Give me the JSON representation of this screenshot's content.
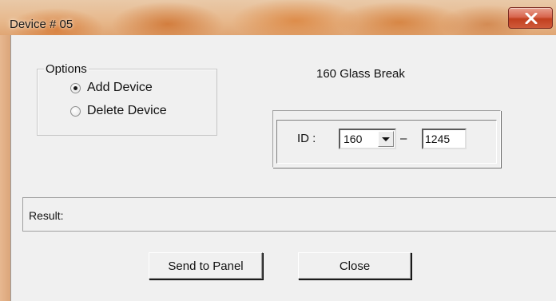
{
  "window": {
    "title": "Device # 05"
  },
  "options": {
    "legend": "Options",
    "items": [
      {
        "label": "Add Device",
        "checked": true
      },
      {
        "label": "Delete Device",
        "checked": false
      }
    ]
  },
  "device": {
    "name": "160 Glass Break"
  },
  "id_field": {
    "label": "ID :",
    "combo_value": "160",
    "separator": "–",
    "input_value": "1245"
  },
  "result": {
    "label": "Result:"
  },
  "buttons": {
    "send_label": "Send to Panel",
    "close_label": "Close"
  },
  "icons": {
    "close": "close-icon",
    "dropdown": "chevron-down-icon"
  }
}
